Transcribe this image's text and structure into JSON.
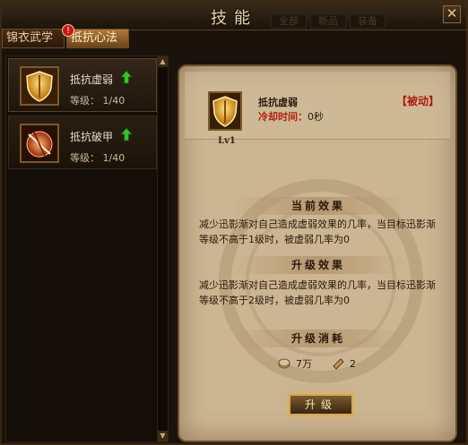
{
  "window": {
    "title": "技能",
    "close_icon": "close-icon",
    "ghost_tabs": [
      "全部",
      "新品",
      "装备"
    ]
  },
  "tabs": [
    {
      "label": "锦衣武学"
    },
    {
      "label": "抵抗心法",
      "badge": "!"
    }
  ],
  "skills": [
    {
      "name": "抵抗虚弱",
      "level_label": "等级：",
      "level": "1/40",
      "icon": "yellow-shield-icon",
      "can_upgrade": true
    },
    {
      "name": "抵抗破甲",
      "level_label": "等级：",
      "level": "1/40",
      "icon": "broken-shield-icon",
      "can_upgrade": true
    }
  ],
  "scrollbar": {
    "up": "▲",
    "down": "▼"
  },
  "detail": {
    "name": "抵抗虚弱",
    "cooldown_label": "冷却时间：",
    "cooldown_value": "0秒",
    "type": "【被动】",
    "level_badge": "Lv1",
    "icon": "yellow-shield-icon",
    "current_effect_title": "当前效果",
    "current_effect_text": "减少迅影渐对自己造成虚弱效果的几率，当目标迅影渐等级不高于1级时，被虚弱几率为0",
    "upgrade_effect_title": "升级效果",
    "upgrade_effect_text": "减少迅影渐对自己造成虚弱效果的几率，当目标迅影渐等级不高于2级时，被虚弱几率为0",
    "cost_title": "升级消耗",
    "costs": [
      {
        "icon": "silver-coin-icon",
        "value": "7万"
      },
      {
        "icon": "skill-scroll-icon",
        "value": "2"
      }
    ],
    "upgrade_button": "升级"
  },
  "colors": {
    "accent": "#b21810",
    "panel_bg": "#cbb592"
  }
}
